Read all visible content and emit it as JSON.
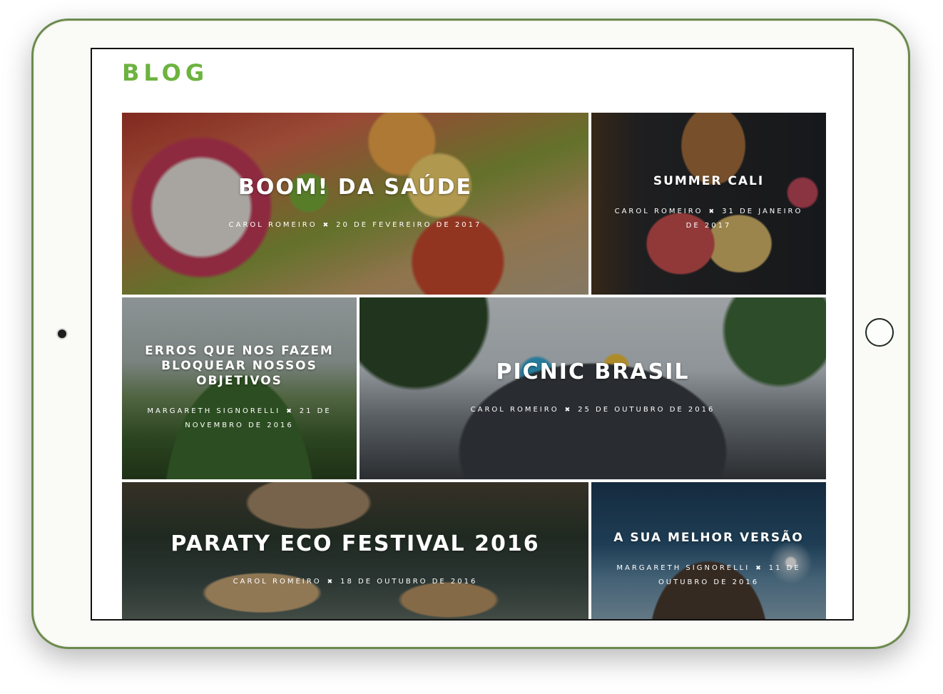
{
  "page": {
    "title": "BLOG"
  },
  "posts": [
    {
      "title": "BOOM! DA SAÚDE",
      "author": "CAROL ROMEIRO",
      "separator": "✖",
      "date": "20 DE FEVEREIRO DE 2017"
    },
    {
      "title": "SUMMER CALI",
      "author": "CAROL ROMEIRO",
      "separator": "✖",
      "date": "31 DE JANEIRO DE 2017"
    },
    {
      "title": "ERROS QUE NOS FAZEM BLOQUEAR NOSSOS OBJETIVOS",
      "author": "MARGARETH SIGNORELLI",
      "separator": "✖",
      "date": "21 DE NOVEMBRO DE 2016"
    },
    {
      "title": "PICNIC BRASIL",
      "author": "CAROL ROMEIRO",
      "separator": "✖",
      "date": "25 DE OUTUBRO DE 2016"
    },
    {
      "title": "PARATY ECO FESTIVAL 2016",
      "author": "CAROL ROMEIRO",
      "separator": "✖",
      "date": "18 DE OUTUBRO DE 2016"
    },
    {
      "title": "A SUA MELHOR VERSÃO",
      "author": "MARGARETH SIGNORELLI",
      "separator": "✖",
      "date": "11 DE OUTUBRO DE 2016"
    }
  ],
  "colors": {
    "accent": "#6cb33f",
    "tablet_border": "#6c8a4f"
  }
}
